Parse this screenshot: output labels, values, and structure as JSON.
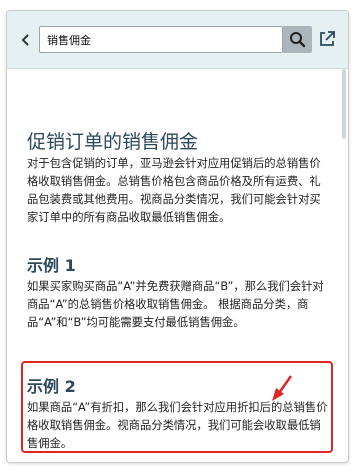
{
  "search": {
    "value": "销售佣金"
  },
  "icons": {
    "back": "chevron-left-icon",
    "search": "search-icon",
    "open": "open-in-new-window-icon",
    "annotation": "red-arrow"
  },
  "colors": {
    "topbar": "#e5f0f2",
    "heading": "#2c4a5c",
    "highlight": "#e02525",
    "search_button": "#aab6bb"
  },
  "article": {
    "title": "促销订单的销售佣金",
    "intro": "对于包含促销的订单，亚马逊会针对应用促销后的总销售价格收取销售佣金。总销售价格包含商品价格及所有运费、礼品包装费或其他费用。视商品分类情况，我们可能会针对买家订单中的所有商品收取最低销售佣金。",
    "example1": {
      "heading": "示例 1",
      "text": "如果买家购买商品“A”并免费获赠商品“B”，那么我们会针对商品“A”的总销售价格收取销售佣金。 根据商品分类，商品“A”和“B”均可能需要支付最低销售佣金。"
    },
    "example2": {
      "heading": "示例 2",
      "text": "如果商品“A”有折扣，那么我们会针对应用折扣后的总销售价格收取销售佣金。视商品分类情况，我们可能会收取最低销售佣金。"
    }
  }
}
